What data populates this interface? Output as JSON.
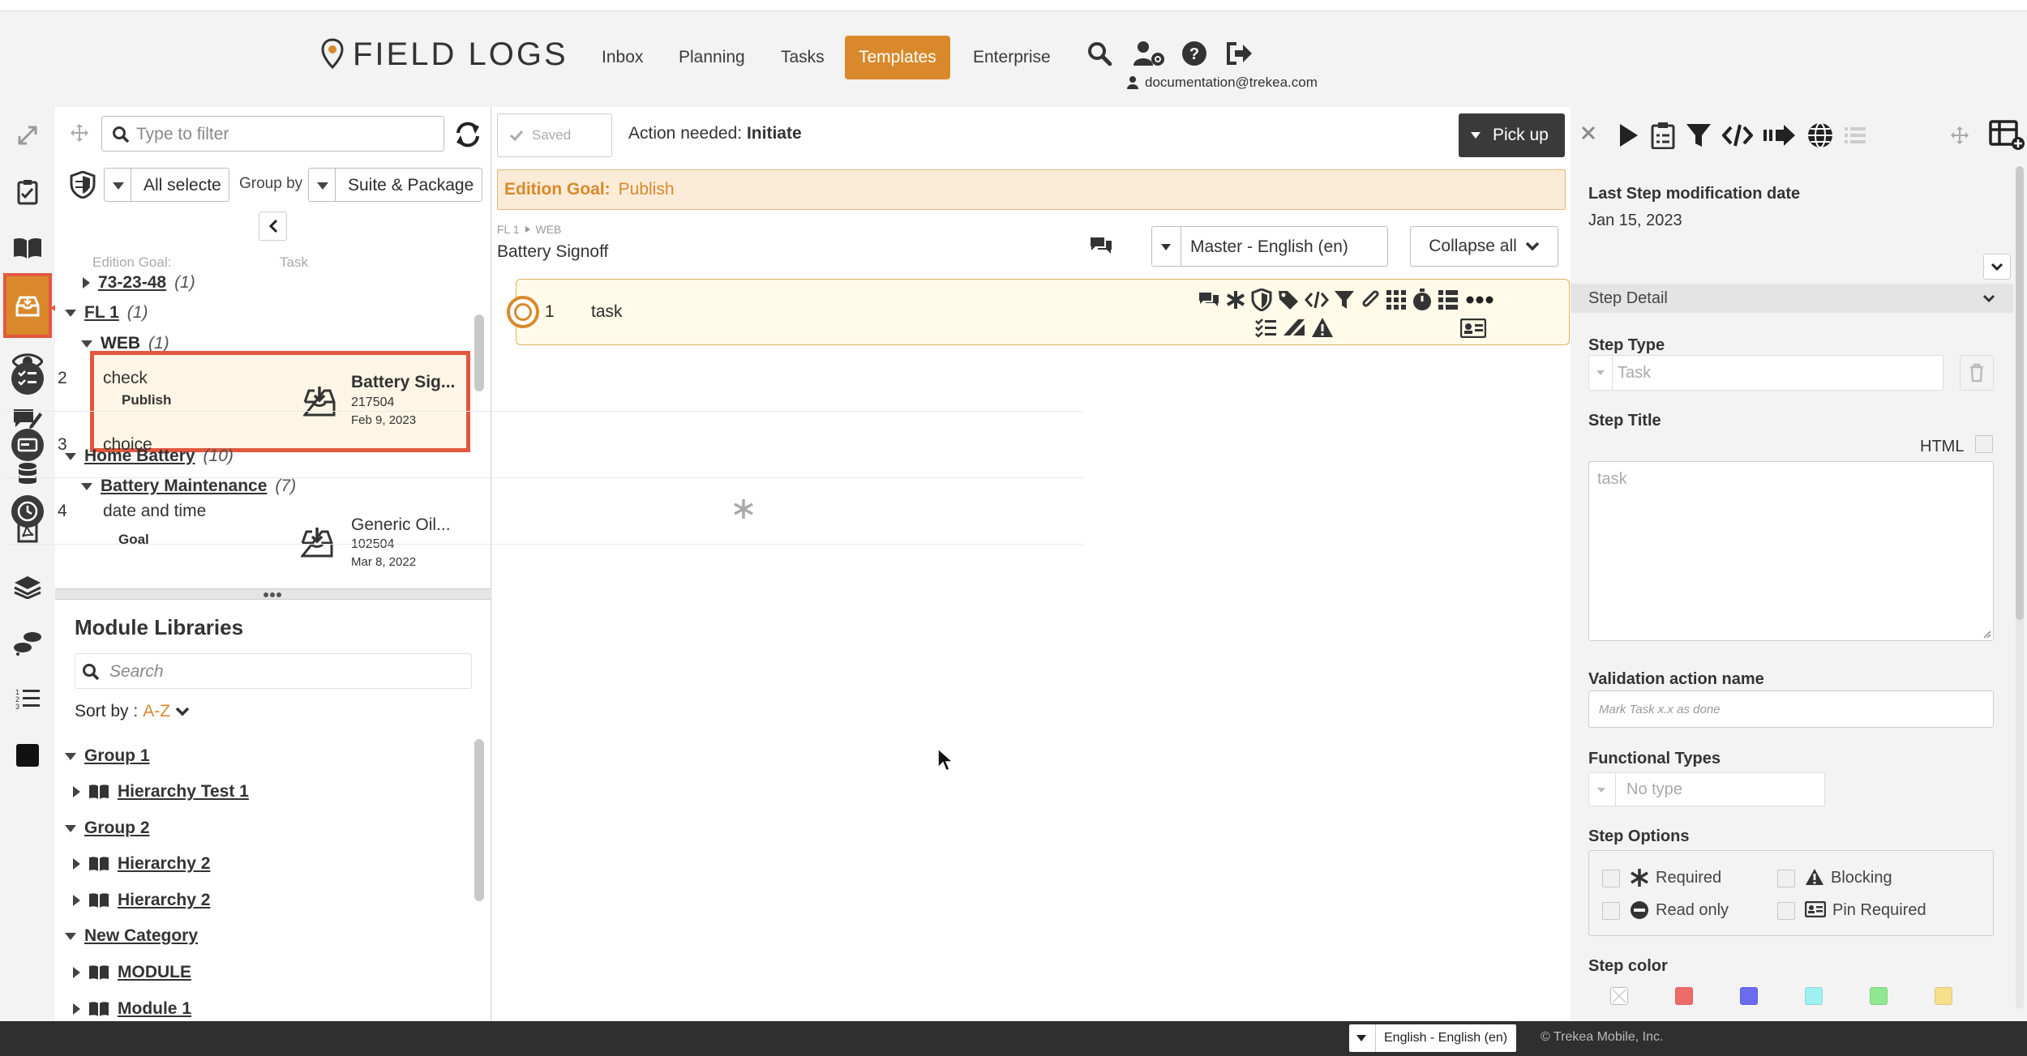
{
  "app": {
    "logo_text": "FIELD LOGS",
    "nav": [
      "Inbox",
      "Planning",
      "Tasks",
      "Templates",
      "Enterprise"
    ],
    "active_nav": "Templates",
    "user_email": "documentation@trekea.com",
    "accent_color": "#d9892b",
    "annotation_color": "#e3573f"
  },
  "left": {
    "filter_placeholder": "Type to filter",
    "selector_value": "All selecte",
    "group_by_label": "Group by",
    "group_by_value": "Suite & Package",
    "column_goal": "Edition Goal:",
    "column_task": "Task",
    "tree": {
      "n1_label": "73-23-48",
      "n1_count": "(1)",
      "n2_label": "FL 1",
      "n2_count": "(1)",
      "n3_label": "WEB",
      "n3_count": "(1)",
      "card1_goal": "Publish",
      "card1_title": "Battery Sig...",
      "card1_id": "217504",
      "card1_date": "Feb 9, 2023",
      "n4_label": "Home Battery",
      "n4_count": "(10)",
      "n5_label": "Battery Maintenance",
      "n5_count": "(7)",
      "card2_goal": "Goal",
      "card2_title": "Generic Oil...",
      "card2_id": "102504",
      "card2_date": "Mar 8, 2022"
    },
    "modules": {
      "title": "Module Libraries",
      "search_placeholder": "Search",
      "sort_label": "Sort by :",
      "sort_value": "A-Z",
      "g1": "Group 1",
      "g1_i1": "Hierarchy Test 1",
      "g2": "Group 2",
      "g2_i1": "Hierarchy 2",
      "g2_i2": "Hierarchy 2",
      "g3": "New Category",
      "g3_i1": "MODULE",
      "g3_i2": "Module 1"
    }
  },
  "center": {
    "saved_label": "Saved",
    "action_prefix": "Action needed:",
    "action_value": "Initiate",
    "pickup_label": "Pick up",
    "goal_label": "Edition Goal:",
    "goal_value": "Publish",
    "crumb_1": "FL 1",
    "crumb_2": "WEB",
    "doc_title": "Battery Signoff",
    "language_value": "Master - English (en)",
    "collapse_label": "Collapse all",
    "steps": [
      {
        "num": "1",
        "name": "task"
      },
      {
        "num": "2",
        "name": "check"
      },
      {
        "num": "3",
        "name": "choice"
      },
      {
        "num": "4",
        "name": "date and time"
      }
    ]
  },
  "right": {
    "mod_date_label": "Last Step modification date",
    "mod_date_value": "Jan 15, 2023",
    "section_title": "Step Detail",
    "step_type_label": "Step Type",
    "step_type_value": "Task",
    "step_title_label": "Step Title",
    "html_label": "HTML",
    "step_title_placeholder": "task",
    "validation_label": "Validation action name",
    "validation_placeholder": "Mark Task x.x as done",
    "functional_label": "Functional Types",
    "functional_value": "No type",
    "options_label": "Step Options",
    "opt_required": "Required",
    "opt_blocking": "Blocking",
    "opt_readonly": "Read only",
    "opt_pin": "Pin Required",
    "color_label": "Step color",
    "colors": [
      "#ffffff",
      "#ef6b6b",
      "#6b6bef",
      "#9ff0f0",
      "#8fe88f",
      "#f6df8a"
    ]
  },
  "footer": {
    "language": "English - English (en)",
    "copyright": "© Trekea Mobile, Inc."
  }
}
